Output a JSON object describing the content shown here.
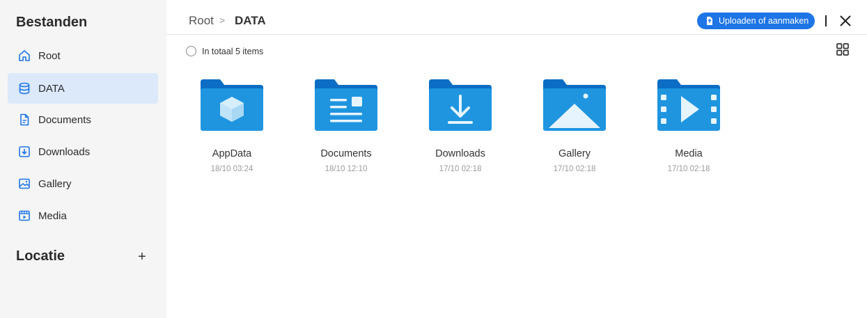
{
  "sidebar": {
    "title": "Bestanden",
    "items": [
      {
        "label": "Root",
        "icon": "home-icon",
        "active": false
      },
      {
        "label": "DATA",
        "icon": "database-icon",
        "active": true
      },
      {
        "label": "Documents",
        "icon": "document-icon",
        "active": false
      },
      {
        "label": "Downloads",
        "icon": "download-icon",
        "active": false
      },
      {
        "label": "Gallery",
        "icon": "image-icon",
        "active": false
      },
      {
        "label": "Media",
        "icon": "video-icon",
        "active": false
      }
    ],
    "location_title": "Locatie",
    "location_add": "+"
  },
  "header": {
    "breadcrumb": {
      "root": "Root",
      "separator": ">",
      "current": "DATA"
    },
    "upload_label": "Uploaden of aanmaken"
  },
  "toolbar": {
    "total_text": "In totaal 5 items"
  },
  "files": [
    {
      "name": "AppData",
      "date": "18/10 03:24",
      "icon": "appdata-folder-icon"
    },
    {
      "name": "Documents",
      "date": "18/10 12:10",
      "icon": "documents-folder-icon"
    },
    {
      "name": "Downloads",
      "date": "17/10 02:18",
      "icon": "downloads-folder-icon"
    },
    {
      "name": "Gallery",
      "date": "17/10 02:18",
      "icon": "gallery-folder-icon"
    },
    {
      "name": "Media",
      "date": "17/10 02:18",
      "icon": "media-folder-icon"
    }
  ],
  "colors": {
    "accent": "#1d75e6",
    "folder_back": "#0b6dc4",
    "folder_front": "#1f95e0",
    "active_nav_bg": "#dce9fb",
    "sidebar_bg": "#f5f5f5"
  }
}
